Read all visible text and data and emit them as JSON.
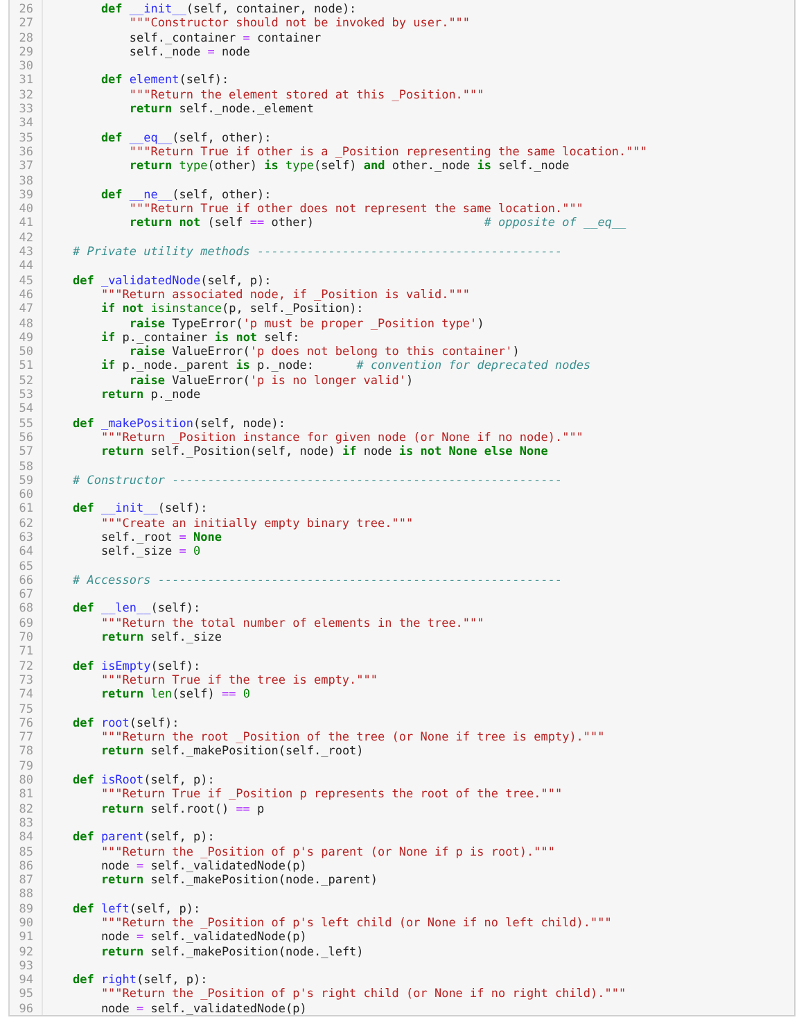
{
  "editor": {
    "lines": [
      {
        "number": "26",
        "tokens": [
          {
            "kind": "keyword",
            "text": "        def"
          },
          {
            "kind": "name",
            "text": " __init__"
          },
          {
            "kind": "plain",
            "text": "(self, container, node):"
          }
        ]
      },
      {
        "number": "27",
        "tokens": [
          {
            "kind": "string",
            "text": "            \"\"\"Constructor should not be invoked by user.\"\"\""
          }
        ]
      },
      {
        "number": "28",
        "tokens": [
          {
            "kind": "plain",
            "text": "            self._container "
          },
          {
            "kind": "operator",
            "text": "="
          },
          {
            "kind": "plain",
            "text": " container"
          }
        ]
      },
      {
        "number": "29",
        "tokens": [
          {
            "kind": "plain",
            "text": "            self._node "
          },
          {
            "kind": "operator",
            "text": "="
          },
          {
            "kind": "plain",
            "text": " node"
          }
        ]
      },
      {
        "number": "30"
      },
      {
        "number": "31",
        "tokens": [
          {
            "kind": "keyword",
            "text": "        def"
          },
          {
            "kind": "name",
            "text": " element"
          },
          {
            "kind": "plain",
            "text": "(self):"
          }
        ]
      },
      {
        "number": "32",
        "tokens": [
          {
            "kind": "string",
            "text": "            \"\"\"Return the element stored at this _Position.\"\"\""
          }
        ]
      },
      {
        "number": "33",
        "tokens": [
          {
            "kind": "keyword",
            "text": "            return"
          },
          {
            "kind": "plain",
            "text": " self._node._element"
          }
        ]
      },
      {
        "number": "34"
      },
      {
        "number": "35",
        "tokens": [
          {
            "kind": "keyword",
            "text": "        def"
          },
          {
            "kind": "name",
            "text": " __eq__"
          },
          {
            "kind": "plain",
            "text": "(self, other):"
          }
        ]
      },
      {
        "number": "36",
        "tokens": [
          {
            "kind": "string",
            "text": "            \"\"\"Return True if other is a _Position representing the same location.\"\"\""
          }
        ]
      },
      {
        "number": "37",
        "tokens": [
          {
            "kind": "keyword",
            "text": "            return"
          },
          {
            "kind": "builtin",
            "text": " type"
          },
          {
            "kind": "plain",
            "text": "(other) "
          },
          {
            "kind": "keyword",
            "text": "is"
          },
          {
            "kind": "builtin",
            "text": " type"
          },
          {
            "kind": "plain",
            "text": "(self) "
          },
          {
            "kind": "keyword",
            "text": "and"
          },
          {
            "kind": "plain",
            "text": " other._node "
          },
          {
            "kind": "keyword",
            "text": "is"
          },
          {
            "kind": "plain",
            "text": " self._node"
          }
        ]
      },
      {
        "number": "38"
      },
      {
        "number": "39",
        "tokens": [
          {
            "kind": "keyword",
            "text": "        def"
          },
          {
            "kind": "name",
            "text": " __ne__"
          },
          {
            "kind": "plain",
            "text": "(self, other):"
          }
        ]
      },
      {
        "number": "40",
        "tokens": [
          {
            "kind": "string",
            "text": "            \"\"\"Return True if other does not represent the same location.\"\"\""
          }
        ]
      },
      {
        "number": "41",
        "tokens": [
          {
            "kind": "keyword",
            "text": "            return not"
          },
          {
            "kind": "plain",
            "text": " (self "
          },
          {
            "kind": "operator",
            "text": "=="
          },
          {
            "kind": "plain",
            "text": " other)"
          },
          {
            "kind": "comment",
            "text": "                        # opposite of __eq__"
          }
        ]
      },
      {
        "number": "42"
      },
      {
        "number": "43",
        "tokens": [
          {
            "kind": "comment",
            "text": "    # Private utility methods -------------------------------------------"
          }
        ]
      },
      {
        "number": "44"
      },
      {
        "number": "45",
        "tokens": [
          {
            "kind": "keyword",
            "text": "    def"
          },
          {
            "kind": "name",
            "text": " _validatedNode"
          },
          {
            "kind": "plain",
            "text": "(self, p):"
          }
        ]
      },
      {
        "number": "46",
        "tokens": [
          {
            "kind": "string",
            "text": "        \"\"\"Return associated node, if _Position is valid.\"\"\""
          }
        ]
      },
      {
        "number": "47",
        "tokens": [
          {
            "kind": "keyword",
            "text": "        if not"
          },
          {
            "kind": "builtin",
            "text": " isinstance"
          },
          {
            "kind": "plain",
            "text": "(p, self._Position):"
          }
        ]
      },
      {
        "number": "48",
        "tokens": [
          {
            "kind": "keyword",
            "text": "            raise"
          },
          {
            "kind": "plain",
            "text": " TypeError("
          },
          {
            "kind": "string",
            "text": "'p must be proper _Position type'"
          },
          {
            "kind": "plain",
            "text": ")"
          }
        ]
      },
      {
        "number": "49",
        "tokens": [
          {
            "kind": "keyword",
            "text": "        if"
          },
          {
            "kind": "plain",
            "text": " p._container "
          },
          {
            "kind": "keyword",
            "text": "is not"
          },
          {
            "kind": "plain",
            "text": " self:"
          }
        ]
      },
      {
        "number": "50",
        "tokens": [
          {
            "kind": "keyword",
            "text": "            raise"
          },
          {
            "kind": "plain",
            "text": " ValueError("
          },
          {
            "kind": "string",
            "text": "'p does not belong to this container'"
          },
          {
            "kind": "plain",
            "text": ")"
          }
        ]
      },
      {
        "number": "51",
        "tokens": [
          {
            "kind": "keyword",
            "text": "        if"
          },
          {
            "kind": "plain",
            "text": " p._node._parent "
          },
          {
            "kind": "keyword",
            "text": "is"
          },
          {
            "kind": "plain",
            "text": " p._node:"
          },
          {
            "kind": "comment",
            "text": "      # convention for deprecated nodes"
          }
        ]
      },
      {
        "number": "52",
        "tokens": [
          {
            "kind": "keyword",
            "text": "            raise"
          },
          {
            "kind": "plain",
            "text": " ValueError("
          },
          {
            "kind": "string",
            "text": "'p is no longer valid'"
          },
          {
            "kind": "plain",
            "text": ")"
          }
        ]
      },
      {
        "number": "53",
        "tokens": [
          {
            "kind": "keyword",
            "text": "        return"
          },
          {
            "kind": "plain",
            "text": " p._node"
          }
        ]
      },
      {
        "number": "54"
      },
      {
        "number": "55",
        "tokens": [
          {
            "kind": "keyword",
            "text": "    def"
          },
          {
            "kind": "name",
            "text": " _makePosition"
          },
          {
            "kind": "plain",
            "text": "(self, node):"
          }
        ]
      },
      {
        "number": "56",
        "tokens": [
          {
            "kind": "string",
            "text": "        \"\"\"Return _Position instance for given node (or None if no node).\"\"\""
          }
        ]
      },
      {
        "number": "57",
        "tokens": [
          {
            "kind": "keyword",
            "text": "        return"
          },
          {
            "kind": "plain",
            "text": " self._Position(self, node) "
          },
          {
            "kind": "keyword",
            "text": "if"
          },
          {
            "kind": "plain",
            "text": " node "
          },
          {
            "kind": "keyword",
            "text": "is not None else None"
          }
        ]
      },
      {
        "number": "58"
      },
      {
        "number": "59",
        "tokens": [
          {
            "kind": "comment",
            "text": "    # Constructor -------------------------------------------------------"
          }
        ]
      },
      {
        "number": "60"
      },
      {
        "number": "61",
        "tokens": [
          {
            "kind": "keyword",
            "text": "    def"
          },
          {
            "kind": "name",
            "text": " __init__"
          },
          {
            "kind": "plain",
            "text": "(self):"
          }
        ]
      },
      {
        "number": "62",
        "tokens": [
          {
            "kind": "string",
            "text": "        \"\"\"Create an initially empty binary tree.\"\"\""
          }
        ]
      },
      {
        "number": "63",
        "tokens": [
          {
            "kind": "plain",
            "text": "        self._root "
          },
          {
            "kind": "operator",
            "text": "="
          },
          {
            "kind": "keyword",
            "text": " None"
          }
        ]
      },
      {
        "number": "64",
        "tokens": [
          {
            "kind": "plain",
            "text": "        self._size "
          },
          {
            "kind": "operator",
            "text": "="
          },
          {
            "kind": "number",
            "text": " 0"
          }
        ]
      },
      {
        "number": "65"
      },
      {
        "number": "66",
        "tokens": [
          {
            "kind": "comment",
            "text": "    # Accessors ---------------------------------------------------------"
          }
        ]
      },
      {
        "number": "67"
      },
      {
        "number": "68",
        "tokens": [
          {
            "kind": "keyword",
            "text": "    def"
          },
          {
            "kind": "name",
            "text": " __len__"
          },
          {
            "kind": "plain",
            "text": "(self):"
          }
        ]
      },
      {
        "number": "69",
        "tokens": [
          {
            "kind": "string",
            "text": "        \"\"\"Return the total number of elements in the tree.\"\"\""
          }
        ]
      },
      {
        "number": "70",
        "tokens": [
          {
            "kind": "keyword",
            "text": "        return"
          },
          {
            "kind": "plain",
            "text": " self._size"
          }
        ]
      },
      {
        "number": "71"
      },
      {
        "number": "72",
        "tokens": [
          {
            "kind": "keyword",
            "text": "    def"
          },
          {
            "kind": "name",
            "text": " isEmpty"
          },
          {
            "kind": "plain",
            "text": "(self):"
          }
        ]
      },
      {
        "number": "73",
        "tokens": [
          {
            "kind": "string",
            "text": "        \"\"\"Return True if the tree is empty.\"\"\""
          }
        ]
      },
      {
        "number": "74",
        "tokens": [
          {
            "kind": "keyword",
            "text": "        return"
          },
          {
            "kind": "builtin",
            "text": " len"
          },
          {
            "kind": "plain",
            "text": "(self) "
          },
          {
            "kind": "operator",
            "text": "=="
          },
          {
            "kind": "number",
            "text": " 0"
          }
        ]
      },
      {
        "number": "75"
      },
      {
        "number": "76",
        "tokens": [
          {
            "kind": "keyword",
            "text": "    def"
          },
          {
            "kind": "name",
            "text": " root"
          },
          {
            "kind": "plain",
            "text": "(self):"
          }
        ]
      },
      {
        "number": "77",
        "tokens": [
          {
            "kind": "string",
            "text": "        \"\"\"Return the root _Position of the tree (or None if tree is empty).\"\"\""
          }
        ]
      },
      {
        "number": "78",
        "tokens": [
          {
            "kind": "keyword",
            "text": "        return"
          },
          {
            "kind": "plain",
            "text": " self._makePosition(self._root)"
          }
        ]
      },
      {
        "number": "79"
      },
      {
        "number": "80",
        "tokens": [
          {
            "kind": "keyword",
            "text": "    def"
          },
          {
            "kind": "name",
            "text": " isRoot"
          },
          {
            "kind": "plain",
            "text": "(self, p):"
          }
        ]
      },
      {
        "number": "81",
        "tokens": [
          {
            "kind": "string",
            "text": "        \"\"\"Return True if _Position p represents the root of the tree.\"\"\""
          }
        ]
      },
      {
        "number": "82",
        "tokens": [
          {
            "kind": "keyword",
            "text": "        return"
          },
          {
            "kind": "plain",
            "text": " self.root() "
          },
          {
            "kind": "operator",
            "text": "=="
          },
          {
            "kind": "plain",
            "text": " p"
          }
        ]
      },
      {
        "number": "83"
      },
      {
        "number": "84",
        "tokens": [
          {
            "kind": "keyword",
            "text": "    def"
          },
          {
            "kind": "name",
            "text": " parent"
          },
          {
            "kind": "plain",
            "text": "(self, p):"
          }
        ]
      },
      {
        "number": "85",
        "tokens": [
          {
            "kind": "string",
            "text": "        \"\"\"Return the _Position of p's parent (or None if p is root).\"\"\""
          }
        ]
      },
      {
        "number": "86",
        "tokens": [
          {
            "kind": "plain",
            "text": "        node "
          },
          {
            "kind": "operator",
            "text": "="
          },
          {
            "kind": "plain",
            "text": " self._validatedNode(p)"
          }
        ]
      },
      {
        "number": "87",
        "tokens": [
          {
            "kind": "keyword",
            "text": "        return"
          },
          {
            "kind": "plain",
            "text": " self._makePosition(node._parent)"
          }
        ]
      },
      {
        "number": "88"
      },
      {
        "number": "89",
        "tokens": [
          {
            "kind": "keyword",
            "text": "    def"
          },
          {
            "kind": "name",
            "text": " left"
          },
          {
            "kind": "plain",
            "text": "(self, p):"
          }
        ]
      },
      {
        "number": "90",
        "tokens": [
          {
            "kind": "string",
            "text": "        \"\"\"Return the _Position of p's left child (or None if no left child).\"\"\""
          }
        ]
      },
      {
        "number": "91",
        "tokens": [
          {
            "kind": "plain",
            "text": "        node "
          },
          {
            "kind": "operator",
            "text": "="
          },
          {
            "kind": "plain",
            "text": " self._validatedNode(p)"
          }
        ]
      },
      {
        "number": "92",
        "tokens": [
          {
            "kind": "keyword",
            "text": "        return"
          },
          {
            "kind": "plain",
            "text": " self._makePosition(node._left)"
          }
        ]
      },
      {
        "number": "93"
      },
      {
        "number": "94",
        "tokens": [
          {
            "kind": "keyword",
            "text": "    def"
          },
          {
            "kind": "name",
            "text": " right"
          },
          {
            "kind": "plain",
            "text": "(self, p):"
          }
        ]
      },
      {
        "number": "95",
        "tokens": [
          {
            "kind": "string",
            "text": "        \"\"\"Return the _Position of p's right child (or None if no right child).\"\"\""
          }
        ]
      },
      {
        "number": "96",
        "tokens": [
          {
            "kind": "plain",
            "text": "        node "
          },
          {
            "kind": "operator",
            "text": "="
          },
          {
            "kind": "plain",
            "text": " self._validatedNode(p)"
          }
        ]
      }
    ]
  }
}
